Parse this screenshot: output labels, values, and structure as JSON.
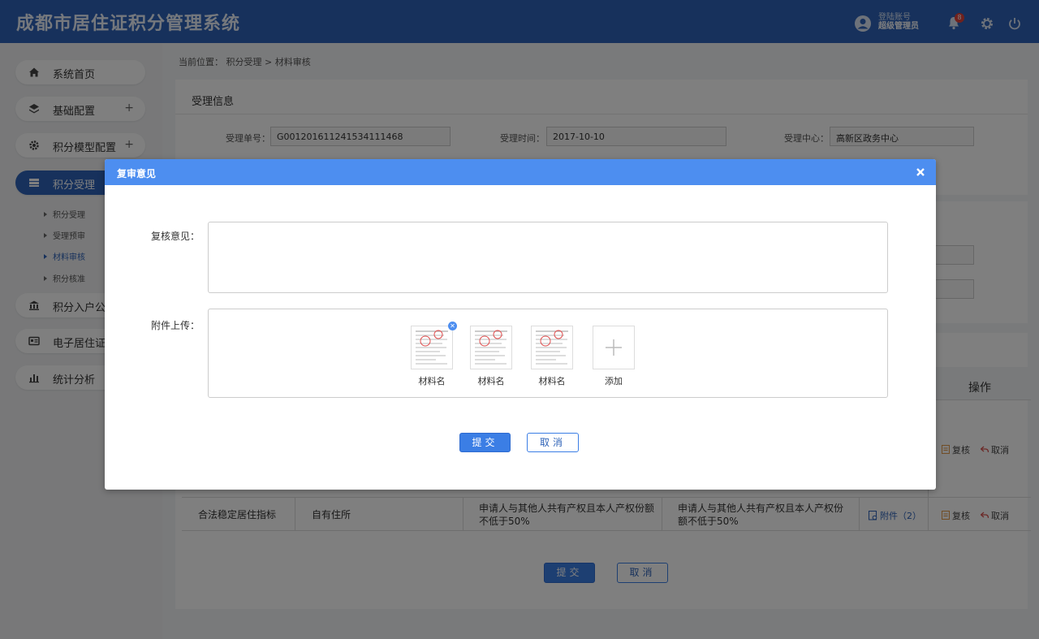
{
  "header": {
    "title": "成都市居住证积分管理系统",
    "login_label": "登陆账号",
    "user_role": "超级管理员",
    "notification_count": "8"
  },
  "sidebar": {
    "items": [
      {
        "label": "系统首页",
        "icon": "home-icon"
      },
      {
        "label": "基础配置",
        "icon": "layers-icon",
        "plus": "+"
      },
      {
        "label": "积分模型配置",
        "icon": "gear-icon",
        "plus": "+"
      },
      {
        "label": "积分受理",
        "icon": "inbox-icon"
      },
      {
        "label": "积分入户公示",
        "icon": "bank-icon"
      },
      {
        "label": "电子居住证管理",
        "icon": "id-card-icon"
      },
      {
        "label": "统计分析",
        "icon": "bar-chart-icon"
      }
    ],
    "sub_items": [
      "积分受理",
      "受理预审",
      "材料审核",
      "积分核准"
    ]
  },
  "breadcrumb": "当前位置： 积分受理 > 材料审核",
  "info_panel": {
    "title": "受理信息",
    "fields": [
      {
        "label": "受理单号：",
        "value": "G001201611241534111468"
      },
      {
        "label": "受理时间：",
        "value": "2017-10-10"
      },
      {
        "label": "受理中心：",
        "value": "高新区政务中心"
      }
    ]
  },
  "table": {
    "op_header": "操作",
    "rows": [
      {
        "review": "复核",
        "cancel": "取消"
      },
      {
        "indicator": "合法稳定居住指标",
        "type": "自有住所",
        "condition": "申请人与其他人共有产权且本人产权份额不低于50%",
        "declared": "申请人与其他人共有产权且本人产权份额不低于50%",
        "attachment": "附件（2）",
        "review": "复核",
        "cancel": "取消"
      }
    ]
  },
  "page_buttons": {
    "submit": "提交",
    "cancel": "取消"
  },
  "modal": {
    "title": "复审意见",
    "opinion_label": "复核意见：",
    "opinion_value": "",
    "attach_label": "附件上传：",
    "files": [
      "材料名",
      "材料名",
      "材料名"
    ],
    "add_label": "添加",
    "submit": "提交",
    "cancel": "取消"
  }
}
